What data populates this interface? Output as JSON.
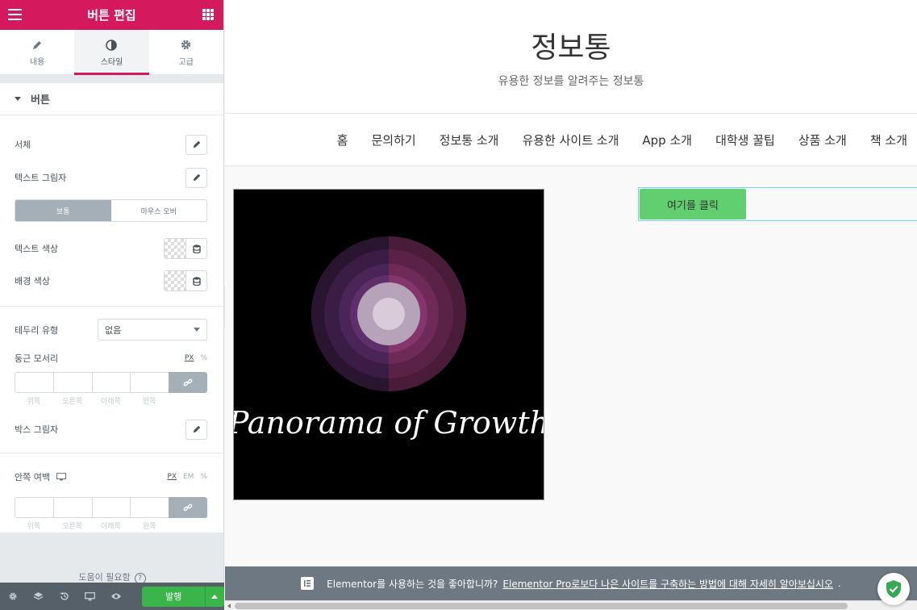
{
  "panel": {
    "title": "버튼 편집",
    "tabs": [
      {
        "label": "내용",
        "icon": "pencil-icon"
      },
      {
        "label": "스타일",
        "icon": "half-circle-icon",
        "active": true
      },
      {
        "label": "고급",
        "icon": "gear-icon"
      }
    ],
    "section_title": "버튼",
    "typography_label": "서체",
    "text_shadow_label": "텍스트 그림자",
    "state_toggle": {
      "normal": "보통",
      "hover": "마우스 오버"
    },
    "text_color_label": "텍스트 색상",
    "bg_color_label": "배경 색상",
    "border_type_label": "테두리 유형",
    "border_type_value": "없음",
    "border_radius_label": "둥근 모서리",
    "radius_units": [
      "PX",
      "%"
    ],
    "dim_labels": [
      "위쪽",
      "오른쪽",
      "아래쪽",
      "왼쪽"
    ],
    "box_shadow_label": "박스 그림자",
    "padding_label": "안쪽 여백",
    "padding_units": [
      "PX",
      "EM",
      "%"
    ],
    "help_text": "도움이 필요함",
    "publish_label": "발행"
  },
  "site": {
    "title": "정보통",
    "tagline": "유용한 정보를 알려주는 정보통",
    "nav": [
      "홈",
      "문의하기",
      "정보통 소개",
      "유용한 사이트 소개",
      "App 소개",
      "대학생 꿀팁",
      "상품 소개",
      "책 소개"
    ],
    "image_text": "Panorama of Growth",
    "button_label": "여기를 클릭"
  },
  "notice": {
    "text_before": "Elementor를 사용하는 것을 좋아합니까?",
    "link_text": "Elementor Pro로보다 나은 사이트를 구축하는 방법에 대해 자세히 알아보십시오",
    "text_after": "."
  },
  "colors": {
    "brand": "#d4195c",
    "button_bg": "#61ce70",
    "publish": "#39b54a"
  }
}
